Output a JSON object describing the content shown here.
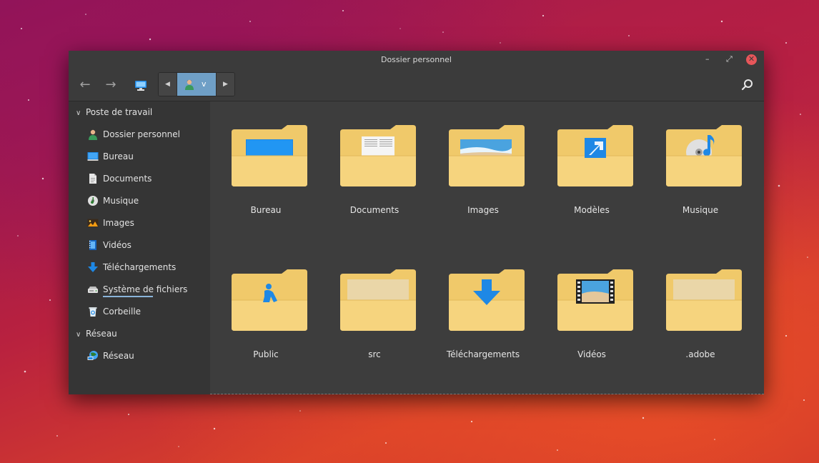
{
  "window": {
    "title": "Dossier personnel",
    "controls": {
      "minimize": "–",
      "maximize": "⤢",
      "close": "✕"
    }
  },
  "toolbar": {
    "back": "←",
    "forward": "→",
    "path": {
      "prev": "◀",
      "next": "▶",
      "crumb": "v"
    }
  },
  "sidebar": {
    "sections": [
      {
        "title": "Poste de travail",
        "items": [
          {
            "label": "Dossier personnel",
            "icon": "user-home-icon"
          },
          {
            "label": "Bureau",
            "icon": "desktop-icon"
          },
          {
            "label": "Documents",
            "icon": "document-icon"
          },
          {
            "label": "Musique",
            "icon": "music-icon"
          },
          {
            "label": "Images",
            "icon": "image-icon"
          },
          {
            "label": "Vidéos",
            "icon": "video-icon"
          },
          {
            "label": "Téléchargements",
            "icon": "download-icon"
          },
          {
            "label": "Système de fichiers",
            "icon": "drive-icon"
          },
          {
            "label": "Corbeille",
            "icon": "trash-icon"
          }
        ]
      },
      {
        "title": "Réseau",
        "items": [
          {
            "label": "Réseau",
            "icon": "network-icon"
          }
        ]
      }
    ]
  },
  "folders": [
    {
      "name": "Bureau",
      "emblem": "desktop"
    },
    {
      "name": "Documents",
      "emblem": "documents"
    },
    {
      "name": "Images",
      "emblem": "images"
    },
    {
      "name": "Modèles",
      "emblem": "templates"
    },
    {
      "name": "Musique",
      "emblem": "music"
    },
    {
      "name": "Public",
      "emblem": "public"
    },
    {
      "name": "src",
      "emblem": "plain"
    },
    {
      "name": "Téléchargements",
      "emblem": "downloads"
    },
    {
      "name": "Vidéos",
      "emblem": "videos"
    },
    {
      "name": ".adobe",
      "emblem": "plain"
    }
  ],
  "colors": {
    "accent": "#6f9fc6",
    "folder": "#f6d47e",
    "emblem": "#1e88e5"
  }
}
